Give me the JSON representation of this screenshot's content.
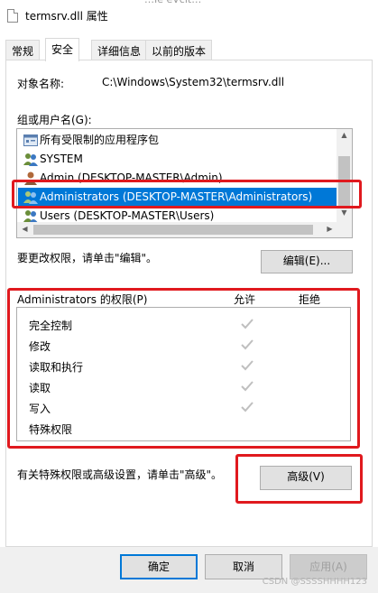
{
  "window": {
    "title": "termsrv.dll 属性",
    "title_behind_fragment": "…Ie  eVclt…"
  },
  "tabs": [
    {
      "label": "常规"
    },
    {
      "label": "安全"
    },
    {
      "label": "详细信息"
    },
    {
      "label": "以前的版本"
    }
  ],
  "active_tab": "安全",
  "object": {
    "label": "对象名称:",
    "value": "C:\\Windows\\System32\\termsrv.dll"
  },
  "groups": {
    "label": "组或用户名(G):",
    "items": [
      {
        "label": "所有受限制的应用程序包",
        "icon": "app-package-icon"
      },
      {
        "label": "SYSTEM",
        "icon": "users-icon"
      },
      {
        "label": "Admin (DESKTOP-MASTER\\Admin)",
        "icon": "user-icon"
      },
      {
        "label": "Administrators (DESKTOP-MASTER\\Administrators)",
        "icon": "users-icon",
        "selected": true
      },
      {
        "label": "Users (DESKTOP-MASTER\\Users)",
        "icon": "users-icon"
      }
    ]
  },
  "edit": {
    "hint": "要更改权限，请单击\"编辑\"。",
    "button": "编辑(E)..."
  },
  "permissions": {
    "header": "Administrators 的权限(P)",
    "allow": "允许",
    "deny": "拒绝",
    "rows": [
      {
        "label": "完全控制",
        "allow": true
      },
      {
        "label": "修改",
        "allow": true
      },
      {
        "label": "读取和执行",
        "allow": true
      },
      {
        "label": "读取",
        "allow": true
      },
      {
        "label": "写入",
        "allow": true
      },
      {
        "label": "特殊权限",
        "allow": false
      }
    ]
  },
  "advanced": {
    "hint": "有关特殊权限或高级设置，请单击\"高级\"。",
    "button": "高级(V)"
  },
  "footer": {
    "ok": "确定",
    "cancel": "取消",
    "apply": "应用(A)"
  },
  "watermark": "CSDN @SSSSHHHH123",
  "colors": {
    "selection": "#0078d7",
    "highlight_box": "#e0191e",
    "check": "#bfbfbf"
  }
}
